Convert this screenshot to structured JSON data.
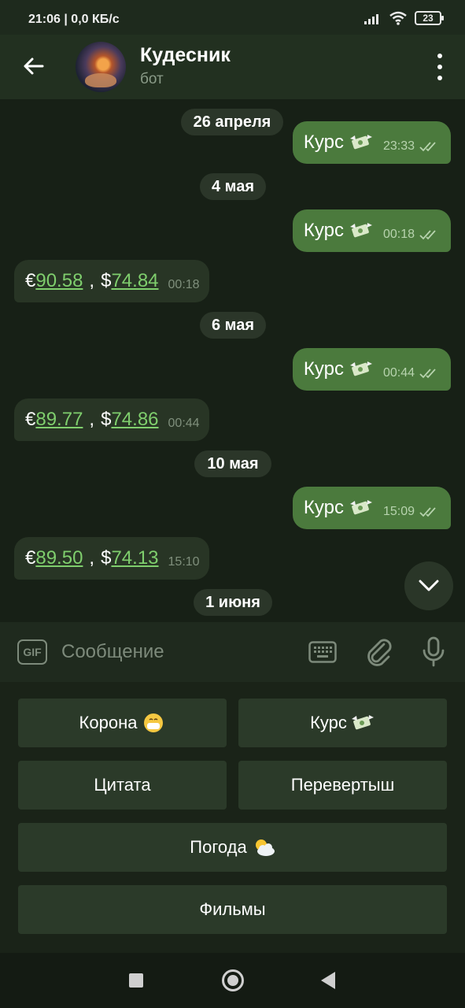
{
  "status_bar": {
    "time_speed": "21:06 | 0,0 КБ/с",
    "battery": "23"
  },
  "header": {
    "title": "Кудесник",
    "subtitle": "бот"
  },
  "messages": [
    {
      "date": "26 апреля"
    },
    {
      "out_text": "Курс",
      "out_time": "23:33"
    },
    {
      "date": "4 мая"
    },
    {
      "out_text": "Курс",
      "out_time": "00:18"
    },
    {
      "in_euro_symbol": "€",
      "in_euro": "90.58",
      "in_sep": ",",
      "in_usd_symbol": "$",
      "in_usd": "74.84",
      "in_time": "00:18"
    },
    {
      "date": "6 мая"
    },
    {
      "out_text": "Курс",
      "out_time": "00:44"
    },
    {
      "in_euro_symbol": "€",
      "in_euro": "89.77",
      "in_sep": ",",
      "in_usd_symbol": "$",
      "in_usd": "74.86",
      "in_time": "00:44"
    },
    {
      "date": "10 мая"
    },
    {
      "out_text": "Курс",
      "out_time": "15:09"
    },
    {
      "in_euro_symbol": "€",
      "in_euro": "89.50",
      "in_sep": ",",
      "in_usd_symbol": "$",
      "in_usd": "74.13",
      "in_time": "15:10"
    },
    {
      "date": "1 июня"
    }
  ],
  "input": {
    "gif_label": "GIF",
    "placeholder": "Сообщение"
  },
  "keyboard": {
    "buttons": [
      {
        "label": "Корона",
        "icon": "mask-face-emoji"
      },
      {
        "label": "Курс",
        "icon": "money-with-wings-emoji"
      },
      {
        "label": "Цитата"
      },
      {
        "label": "Перевертыш"
      },
      {
        "label": "Погода",
        "icon": "sun-behind-cloud-emoji"
      },
      {
        "label": "Фильмы"
      }
    ]
  },
  "colors": {
    "outgoing_bubble": "#4b7a3d",
    "incoming_bubble": "#283525",
    "link": "#7fce6d",
    "background": "#172016"
  }
}
